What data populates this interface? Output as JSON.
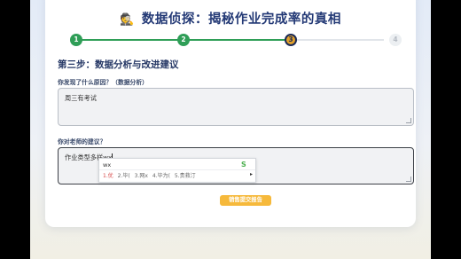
{
  "header": {
    "emoji": "🕵️",
    "title": "数据侦探：揭秘作业完成率的真相"
  },
  "progress": {
    "steps": [
      "1",
      "2",
      "3",
      "4"
    ],
    "current_step": 3,
    "colors": {
      "done": "#2f9e57",
      "active": "#e1a02b",
      "todo": "#eceff2"
    }
  },
  "section": {
    "title": "第三步：数据分析与改进建议"
  },
  "q1": {
    "label": "你发现了什么原因？（数据分析）",
    "value": "周三有考试"
  },
  "q2": {
    "label": "你对老师的建议？",
    "value": "作业类型多样wx"
  },
  "ime": {
    "composition": "wx",
    "candidates": [
      "1.优",
      "2.毕(",
      "3.网x",
      "4.毕为(",
      "5.贵救汀"
    ],
    "next_icon": "▸"
  },
  "actions": {
    "submit_label": "销售提交报告"
  },
  "colors": {
    "title": "#243a76",
    "submit": "#f6b93b"
  }
}
